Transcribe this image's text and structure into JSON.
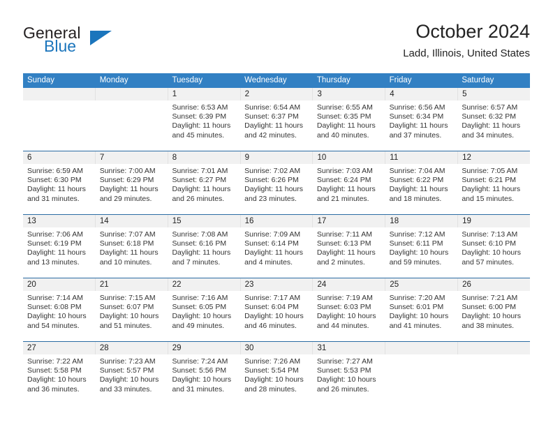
{
  "brand": {
    "name_top": "General",
    "name_bottom": "Blue",
    "triangle_color": "#1b75bc",
    "text_color": "#231f20"
  },
  "header": {
    "title": "October 2024",
    "subtitle": "Ladd, Illinois, United States"
  },
  "colors": {
    "weekday_header_bg": "#3280c3",
    "weekday_header_text": "#ffffff",
    "daynum_band_bg": "#f1f1f1",
    "row_divider": "#2b6ca3"
  },
  "weekdays": [
    "Sunday",
    "Monday",
    "Tuesday",
    "Wednesday",
    "Thursday",
    "Friday",
    "Saturday"
  ],
  "weeks": [
    [
      {
        "day": "",
        "sunrise": "",
        "sunset": "",
        "daylight": "",
        "daylight2": ""
      },
      {
        "day": "",
        "sunrise": "",
        "sunset": "",
        "daylight": "",
        "daylight2": ""
      },
      {
        "day": "1",
        "sunrise": "Sunrise: 6:53 AM",
        "sunset": "Sunset: 6:39 PM",
        "daylight": "Daylight: 11 hours",
        "daylight2": "and 45 minutes."
      },
      {
        "day": "2",
        "sunrise": "Sunrise: 6:54 AM",
        "sunset": "Sunset: 6:37 PM",
        "daylight": "Daylight: 11 hours",
        "daylight2": "and 42 minutes."
      },
      {
        "day": "3",
        "sunrise": "Sunrise: 6:55 AM",
        "sunset": "Sunset: 6:35 PM",
        "daylight": "Daylight: 11 hours",
        "daylight2": "and 40 minutes."
      },
      {
        "day": "4",
        "sunrise": "Sunrise: 6:56 AM",
        "sunset": "Sunset: 6:34 PM",
        "daylight": "Daylight: 11 hours",
        "daylight2": "and 37 minutes."
      },
      {
        "day": "5",
        "sunrise": "Sunrise: 6:57 AM",
        "sunset": "Sunset: 6:32 PM",
        "daylight": "Daylight: 11 hours",
        "daylight2": "and 34 minutes."
      }
    ],
    [
      {
        "day": "6",
        "sunrise": "Sunrise: 6:59 AM",
        "sunset": "Sunset: 6:30 PM",
        "daylight": "Daylight: 11 hours",
        "daylight2": "and 31 minutes."
      },
      {
        "day": "7",
        "sunrise": "Sunrise: 7:00 AM",
        "sunset": "Sunset: 6:29 PM",
        "daylight": "Daylight: 11 hours",
        "daylight2": "and 29 minutes."
      },
      {
        "day": "8",
        "sunrise": "Sunrise: 7:01 AM",
        "sunset": "Sunset: 6:27 PM",
        "daylight": "Daylight: 11 hours",
        "daylight2": "and 26 minutes."
      },
      {
        "day": "9",
        "sunrise": "Sunrise: 7:02 AM",
        "sunset": "Sunset: 6:26 PM",
        "daylight": "Daylight: 11 hours",
        "daylight2": "and 23 minutes."
      },
      {
        "day": "10",
        "sunrise": "Sunrise: 7:03 AM",
        "sunset": "Sunset: 6:24 PM",
        "daylight": "Daylight: 11 hours",
        "daylight2": "and 21 minutes."
      },
      {
        "day": "11",
        "sunrise": "Sunrise: 7:04 AM",
        "sunset": "Sunset: 6:22 PM",
        "daylight": "Daylight: 11 hours",
        "daylight2": "and 18 minutes."
      },
      {
        "day": "12",
        "sunrise": "Sunrise: 7:05 AM",
        "sunset": "Sunset: 6:21 PM",
        "daylight": "Daylight: 11 hours",
        "daylight2": "and 15 minutes."
      }
    ],
    [
      {
        "day": "13",
        "sunrise": "Sunrise: 7:06 AM",
        "sunset": "Sunset: 6:19 PM",
        "daylight": "Daylight: 11 hours",
        "daylight2": "and 13 minutes."
      },
      {
        "day": "14",
        "sunrise": "Sunrise: 7:07 AM",
        "sunset": "Sunset: 6:18 PM",
        "daylight": "Daylight: 11 hours",
        "daylight2": "and 10 minutes."
      },
      {
        "day": "15",
        "sunrise": "Sunrise: 7:08 AM",
        "sunset": "Sunset: 6:16 PM",
        "daylight": "Daylight: 11 hours",
        "daylight2": "and 7 minutes."
      },
      {
        "day": "16",
        "sunrise": "Sunrise: 7:09 AM",
        "sunset": "Sunset: 6:14 PM",
        "daylight": "Daylight: 11 hours",
        "daylight2": "and 4 minutes."
      },
      {
        "day": "17",
        "sunrise": "Sunrise: 7:11 AM",
        "sunset": "Sunset: 6:13 PM",
        "daylight": "Daylight: 11 hours",
        "daylight2": "and 2 minutes."
      },
      {
        "day": "18",
        "sunrise": "Sunrise: 7:12 AM",
        "sunset": "Sunset: 6:11 PM",
        "daylight": "Daylight: 10 hours",
        "daylight2": "and 59 minutes."
      },
      {
        "day": "19",
        "sunrise": "Sunrise: 7:13 AM",
        "sunset": "Sunset: 6:10 PM",
        "daylight": "Daylight: 10 hours",
        "daylight2": "and 57 minutes."
      }
    ],
    [
      {
        "day": "20",
        "sunrise": "Sunrise: 7:14 AM",
        "sunset": "Sunset: 6:08 PM",
        "daylight": "Daylight: 10 hours",
        "daylight2": "and 54 minutes."
      },
      {
        "day": "21",
        "sunrise": "Sunrise: 7:15 AM",
        "sunset": "Sunset: 6:07 PM",
        "daylight": "Daylight: 10 hours",
        "daylight2": "and 51 minutes."
      },
      {
        "day": "22",
        "sunrise": "Sunrise: 7:16 AM",
        "sunset": "Sunset: 6:05 PM",
        "daylight": "Daylight: 10 hours",
        "daylight2": "and 49 minutes."
      },
      {
        "day": "23",
        "sunrise": "Sunrise: 7:17 AM",
        "sunset": "Sunset: 6:04 PM",
        "daylight": "Daylight: 10 hours",
        "daylight2": "and 46 minutes."
      },
      {
        "day": "24",
        "sunrise": "Sunrise: 7:19 AM",
        "sunset": "Sunset: 6:03 PM",
        "daylight": "Daylight: 10 hours",
        "daylight2": "and 44 minutes."
      },
      {
        "day": "25",
        "sunrise": "Sunrise: 7:20 AM",
        "sunset": "Sunset: 6:01 PM",
        "daylight": "Daylight: 10 hours",
        "daylight2": "and 41 minutes."
      },
      {
        "day": "26",
        "sunrise": "Sunrise: 7:21 AM",
        "sunset": "Sunset: 6:00 PM",
        "daylight": "Daylight: 10 hours",
        "daylight2": "and 38 minutes."
      }
    ],
    [
      {
        "day": "27",
        "sunrise": "Sunrise: 7:22 AM",
        "sunset": "Sunset: 5:58 PM",
        "daylight": "Daylight: 10 hours",
        "daylight2": "and 36 minutes."
      },
      {
        "day": "28",
        "sunrise": "Sunrise: 7:23 AM",
        "sunset": "Sunset: 5:57 PM",
        "daylight": "Daylight: 10 hours",
        "daylight2": "and 33 minutes."
      },
      {
        "day": "29",
        "sunrise": "Sunrise: 7:24 AM",
        "sunset": "Sunset: 5:56 PM",
        "daylight": "Daylight: 10 hours",
        "daylight2": "and 31 minutes."
      },
      {
        "day": "30",
        "sunrise": "Sunrise: 7:26 AM",
        "sunset": "Sunset: 5:54 PM",
        "daylight": "Daylight: 10 hours",
        "daylight2": "and 28 minutes."
      },
      {
        "day": "31",
        "sunrise": "Sunrise: 7:27 AM",
        "sunset": "Sunset: 5:53 PM",
        "daylight": "Daylight: 10 hours",
        "daylight2": "and 26 minutes."
      },
      {
        "day": "",
        "sunrise": "",
        "sunset": "",
        "daylight": "",
        "daylight2": ""
      },
      {
        "day": "",
        "sunrise": "",
        "sunset": "",
        "daylight": "",
        "daylight2": ""
      }
    ]
  ]
}
